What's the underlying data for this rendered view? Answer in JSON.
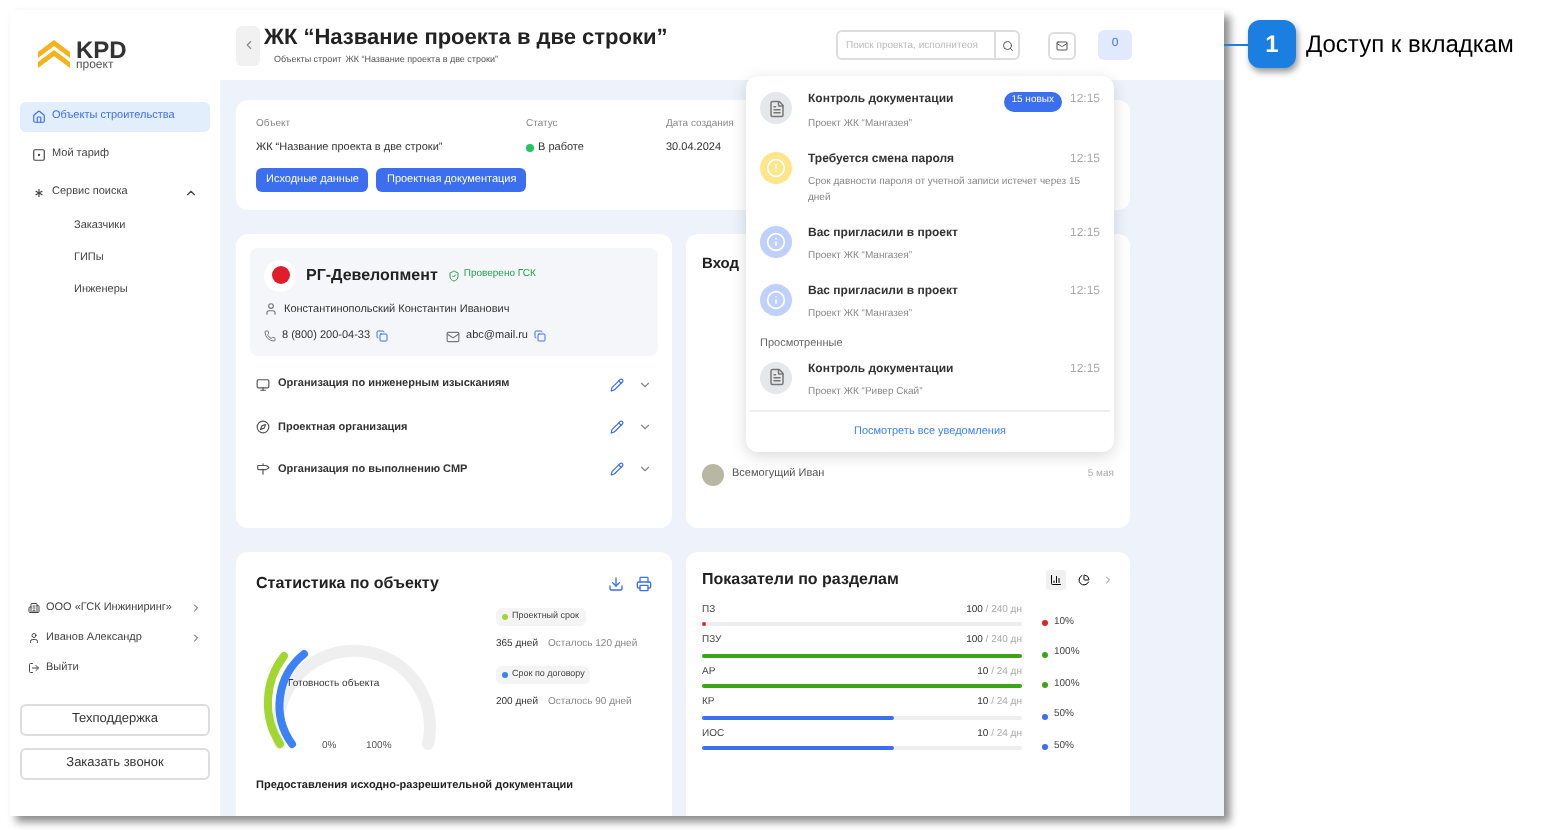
{
  "callout": {
    "number": "1",
    "text": "Доступ к вкладкам"
  },
  "logo": {
    "brand": "KPD",
    "sub": "проект"
  },
  "sidebar": {
    "items": [
      {
        "label": "Объекты строительства",
        "selected": true
      },
      {
        "label": "Мой тариф",
        "selected": false
      },
      {
        "label": "Сервис поиска",
        "selected": false,
        "expanded": true,
        "children": [
          {
            "label": "Заказчики",
            "selected": false
          },
          {
            "label": "ГИПы",
            "selected": false
          },
          {
            "label": "Инженеры",
            "selected": false
          }
        ]
      }
    ],
    "bottom_items": [
      {
        "label": "ООО «ГСК Инжиниринг»"
      },
      {
        "label": "Иванов Александр"
      }
    ],
    "logout": "Выйти",
    "buttons": [
      "Техподдержка",
      "Заказать звонок"
    ]
  },
  "header": {
    "title": "ЖК “Название проекта в две строки”",
    "breadcrumb": [
      "Объекты строит",
      "ЖК “Название проекта в две строки”"
    ],
    "search": {
      "placeholder": "Поиск проекта, исполнитеоя"
    },
    "notifications_count": "0"
  },
  "project": {
    "fields": [
      {
        "label": "Объект",
        "value": "ЖК “Название проекта в две строки”"
      },
      {
        "label": "Статус",
        "value": "В работе",
        "color": "#22c55e"
      },
      {
        "label": "Дата создания",
        "value": "30.04.2024"
      }
    ],
    "buttons": [
      "Исходные данные",
      "Проектная документация"
    ]
  },
  "developer": {
    "name": "РГ-Девелопмент",
    "verified": "Проверено ГСК",
    "person": "Константинопольский Константин Иванович",
    "phone": "8 (800) 200-04-33",
    "email": "abc@mail.ru",
    "orgs": [
      {
        "label": "Организация по инженерным изысканиям",
        "kind": "survey"
      },
      {
        "label": "Проектная организация",
        "kind": "design"
      },
      {
        "label": "Организация по выполнению СМР",
        "kind": "build"
      }
    ]
  },
  "incoming": {
    "title": "Вход",
    "last": {
      "name": "Всемогущий Иван",
      "date": "5 мая"
    }
  },
  "notifications": {
    "unread": [
      {
        "kind": "document",
        "title": "Контроль документации",
        "badge": "15 новых",
        "time": "12:15",
        "text": "Проект ЖК “Мангазея”"
      },
      {
        "kind": "warning",
        "title": "Требуется смена пароля",
        "time": "12:15",
        "text": "Срок давности пароля от учетной записи истечет через 15 дней"
      },
      {
        "kind": "info",
        "title": "Вас пригласили в проект",
        "time": "12:15",
        "text": "Проект ЖК “Мангазея”"
      },
      {
        "kind": "info",
        "title": "Вас пригласили в проект",
        "time": "12:15",
        "text": "Проект ЖК “Мангазея”"
      }
    ],
    "viewed_heading": "Просмотренные",
    "viewed": [
      {
        "kind": "document",
        "title": "Контроль документации",
        "time": "12:15",
        "text": "Проект ЖК “Ривер Скай”"
      }
    ],
    "footer": "Посмотреть все уведомления"
  },
  "stats": {
    "title": "Статистика по объекту",
    "gauge_label": "Готовность объекта",
    "min": "0%",
    "max": "100%",
    "terms": [
      {
        "label": "Проектный срок",
        "color": "#a3d631",
        "days": "365 дней",
        "left": "Осталось 120 дней"
      },
      {
        "label": "Срок по договору",
        "color": "#3b82f6",
        "days": "200 дней",
        "left": "Осталось 90 дней"
      }
    ],
    "footer": "Предоставления исходно-разрешительной документации"
  },
  "sections": {
    "title": "Показатели по разделам",
    "rows": [
      {
        "name": "ПЗ",
        "done": "100",
        "total": "/ 240 дн",
        "level": 0.01,
        "color": "#dc2626",
        "percent": "10%"
      },
      {
        "name": "ПЗУ",
        "done": "100",
        "total": "/ 240 дн",
        "level": 1,
        "color": "#3fa31a",
        "percent": "100%"
      },
      {
        "name": "АР",
        "done": "10",
        "total": "/ 24 дн",
        "level": 1,
        "color": "#3fa31a",
        "percent": "100%"
      },
      {
        "name": "КР",
        "done": "10",
        "total": "/ 24 дн",
        "level": 0.6,
        "color": "#3b6ff0",
        "percent": "50%"
      },
      {
        "name": "ИОС",
        "done": "10",
        "total": "/ 24 дн",
        "level": 0.6,
        "color": "#3b6ff0",
        "percent": "50%"
      }
    ]
  }
}
